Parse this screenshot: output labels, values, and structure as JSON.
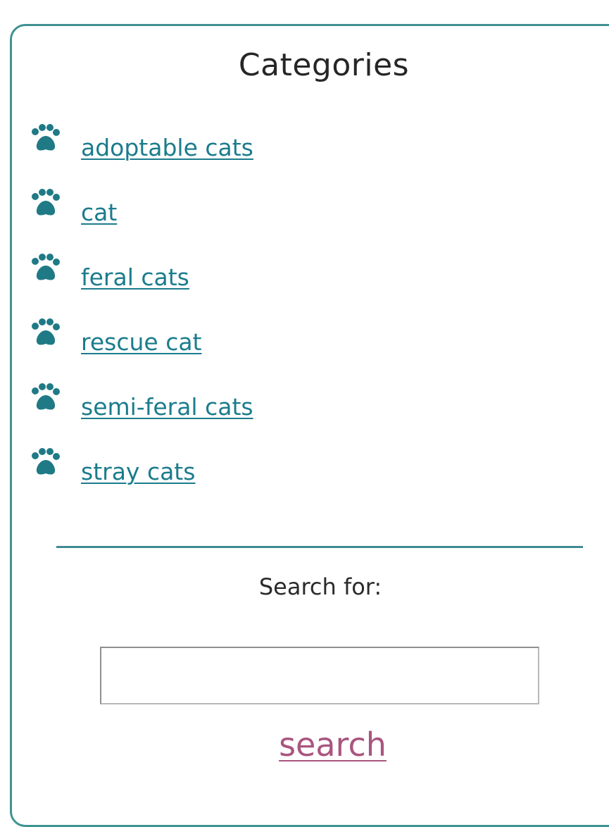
{
  "sidebar": {
    "title": "Categories",
    "items": [
      {
        "label": "adoptable cats",
        "icon": "paw-icon"
      },
      {
        "label": "cat",
        "icon": "paw-icon"
      },
      {
        "label": "feral cats",
        "icon": "paw-icon"
      },
      {
        "label": "rescue cat",
        "icon": "paw-icon"
      },
      {
        "label": "semi-feral cats",
        "icon": "paw-icon"
      },
      {
        "label": "stray cats",
        "icon": "paw-icon"
      }
    ]
  },
  "search": {
    "label": "Search for:",
    "value": "",
    "button_label": "search"
  },
  "colors": {
    "border": "#3f9390",
    "link": "#1b7c8c",
    "paw": "#1f7a86",
    "search_link": "#a9557f"
  }
}
